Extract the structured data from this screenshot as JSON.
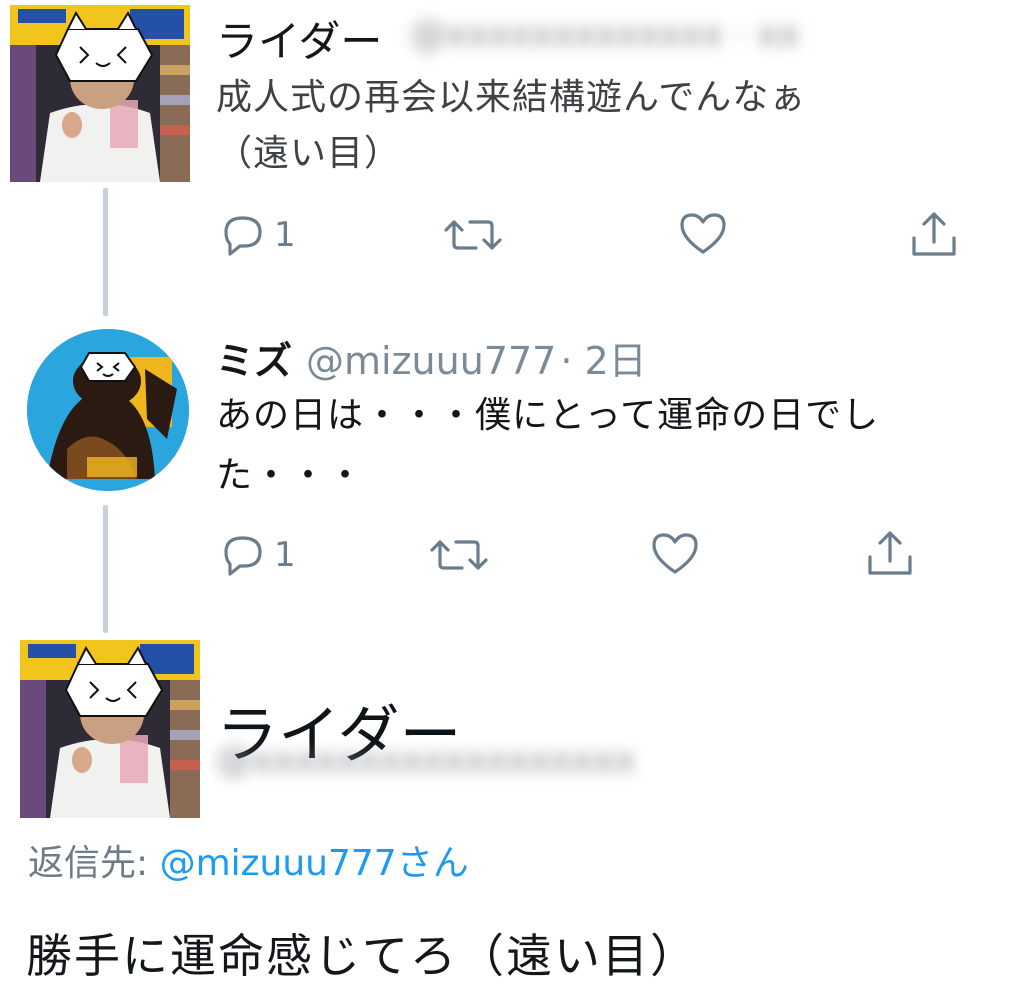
{
  "tweet1": {
    "name": "ライダー",
    "handle_blurred": "@xxxxxxxxxxxxx · xx",
    "text_line1": "成人式の再会以来結構遊んでんなぁ",
    "text_line2": "（遠い目）",
    "reply_count": "1"
  },
  "tweet2": {
    "name": "ミズ",
    "handle": "@mizuuu777",
    "date": "· 2日",
    "text_line1": "あの日は・・・僕にとって運命の日でし",
    "text_line2": "た・・・",
    "reply_count": "1"
  },
  "tweet3": {
    "name": "ライダー",
    "handle_blurred": "@xxxxxxxxxxxxxxxxxx",
    "reply_label": "返信先: ",
    "reply_handle": "@mizuuu777さん",
    "text": "勝手に運命感じてろ（遠い目）"
  },
  "icons": {
    "reply": "speech-bubble-icon",
    "retweet": "retweet-arrows-icon",
    "like": "heart-icon",
    "share": "share-upload-icon"
  },
  "colors": {
    "accent": "#1d9bf0",
    "icon": "#6b7c8c",
    "thread_line": "#c5d0da"
  }
}
